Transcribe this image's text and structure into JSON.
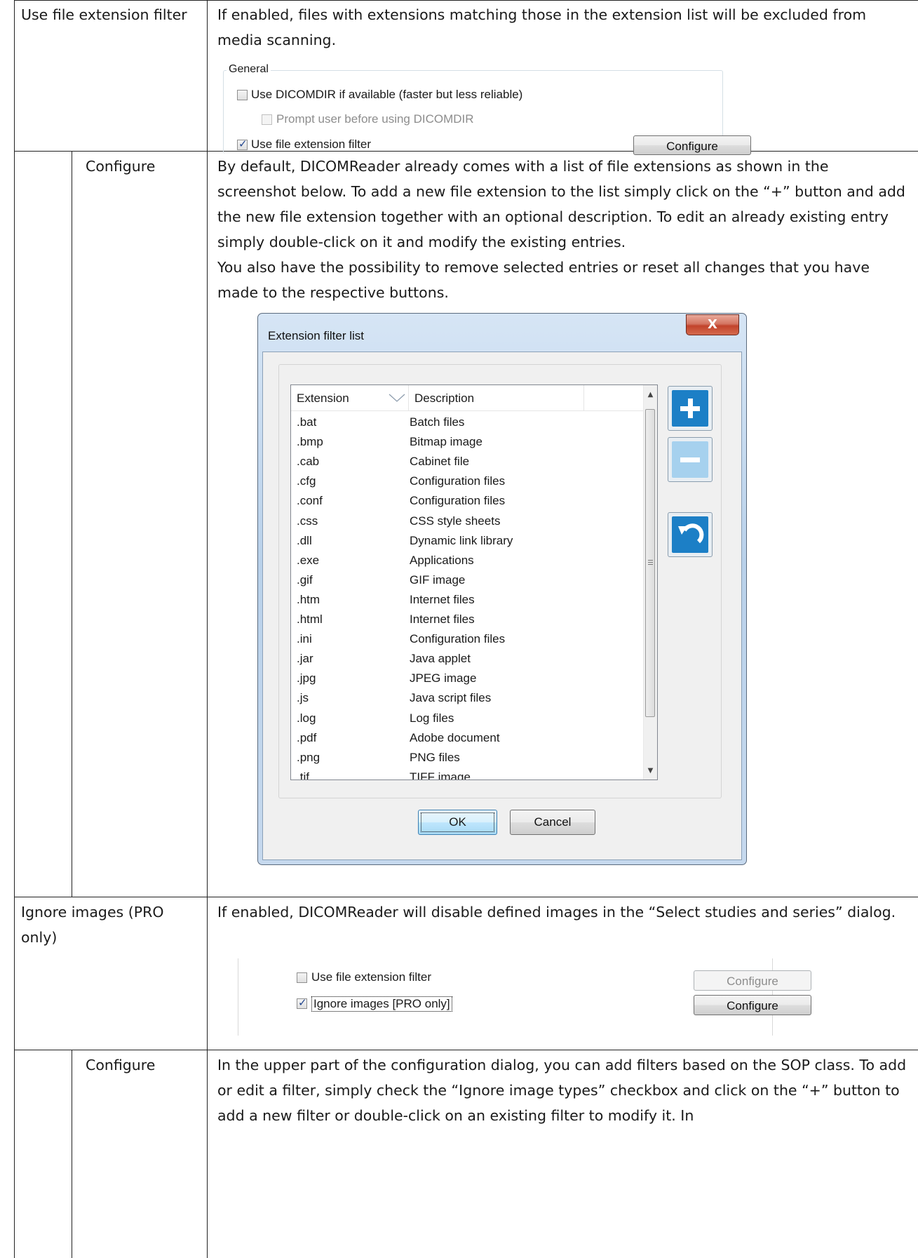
{
  "rows": [
    {
      "label": "Use file extension filter",
      "body": [
        "If enabled, files with extensions matching those in the extension list will be excluded from media scanning."
      ]
    },
    {
      "label": "Configure",
      "body": [
        "By default, DICOMReader already comes with a list of file extensions as shown in the screenshot below. To add a new file extension to the list simply click on the “+” button and add the new file extension together with an optional description. To edit an already existing entry simply double-click on it and modify the existing entries.",
        "You also have the possibility to remove selected entries or reset all changes that you have made to the respective buttons."
      ]
    },
    {
      "label": "Ignore images (PRO only)",
      "body": [
        "If enabled, DICOMReader will disable defined images in the “Select studies and series” dialog."
      ]
    },
    {
      "label": "Configure",
      "body": [
        "In the upper part of the configuration dialog, you can add filters based on the SOP class. To add or edit a filter, simply check the “Ignore image types” checkbox and click on the “+” button to add a new filter or double-click on an existing filter to modify it. In"
      ]
    }
  ],
  "general_group": {
    "legend": "General",
    "use_dicomdir": {
      "label": "Use DICOMDIR if available (faster but less reliable)",
      "checked": false
    },
    "prompt_user": {
      "label": "Prompt user before using DICOMDIR",
      "checked": false,
      "enabled": false
    },
    "use_filter": {
      "label": "Use file extension filter",
      "checked": true
    },
    "configure_label": "Configure"
  },
  "dialog": {
    "title": "Extension filter list",
    "close_glyph": "X",
    "columns": [
      "Extension",
      "Description"
    ],
    "entries": [
      {
        "ext": ".bat",
        "desc": "Batch files"
      },
      {
        "ext": ".bmp",
        "desc": "Bitmap image"
      },
      {
        "ext": ".cab",
        "desc": "Cabinet file"
      },
      {
        "ext": ".cfg",
        "desc": "Configuration files"
      },
      {
        "ext": ".conf",
        "desc": "Configuration files"
      },
      {
        "ext": ".css",
        "desc": "CSS style sheets"
      },
      {
        "ext": ".dll",
        "desc": "Dynamic link library"
      },
      {
        "ext": ".exe",
        "desc": "Applications"
      },
      {
        "ext": ".gif",
        "desc": "GIF image"
      },
      {
        "ext": ".htm",
        "desc": "Internet files"
      },
      {
        "ext": ".html",
        "desc": "Internet files"
      },
      {
        "ext": ".ini",
        "desc": "Configuration files"
      },
      {
        "ext": ".jar",
        "desc": "Java applet"
      },
      {
        "ext": ".jpg",
        "desc": "JPEG image"
      },
      {
        "ext": ".js",
        "desc": "Java script files"
      },
      {
        "ext": ".log",
        "desc": "Log files"
      },
      {
        "ext": ".pdf",
        "desc": "Adobe document"
      },
      {
        "ext": ".png",
        "desc": "PNG files"
      },
      {
        "ext": ".tif",
        "desc": "TIFF image"
      }
    ],
    "ok_label": "OK",
    "cancel_label": "Cancel",
    "side_icons": [
      "add-icon",
      "remove-icon",
      "reset-icon"
    ]
  },
  "ignore_snippet": {
    "use_filter": {
      "label": "Use file extension filter",
      "checked": false
    },
    "ignore_images": {
      "label": "Ignore images [PRO only]",
      "checked": true
    },
    "configure_disabled_label": "Configure",
    "configure_label": "Configure"
  },
  "colors": {
    "accent_blue": "#1c7fc6",
    "disabled_blue": "#a6d1ee",
    "close_red": "#c9452c"
  }
}
